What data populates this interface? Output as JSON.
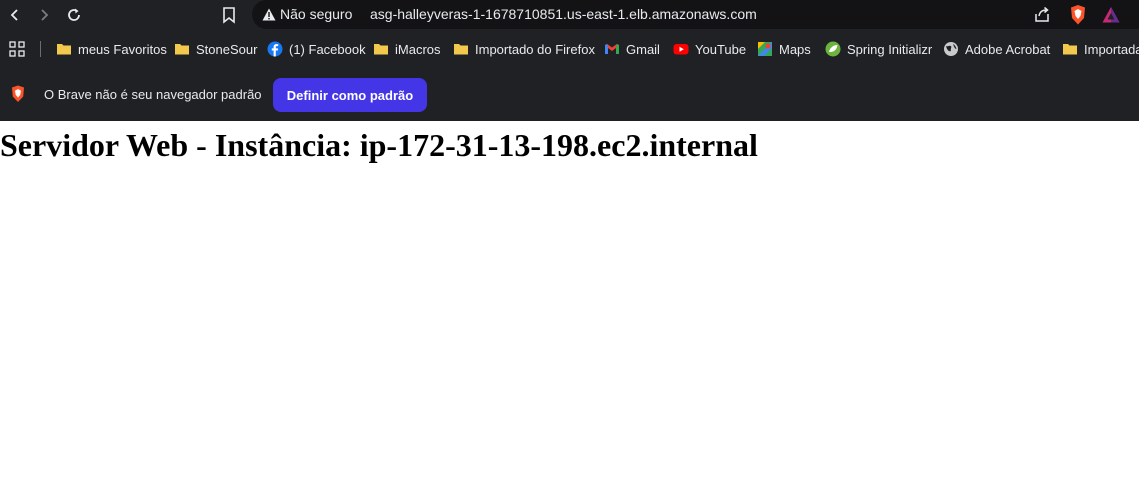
{
  "toolbar": {
    "security_label": "Não seguro",
    "url": "asg-halleyveras-1-1678710851.us-east-1.elb.amazonaws.com"
  },
  "bookmarks": [
    {
      "label": "meus Favoritos",
      "icon": "folder-icon"
    },
    {
      "label": "StoneSour",
      "icon": "folder-icon"
    },
    {
      "label": "(1) Facebook",
      "icon": "facebook-icon"
    },
    {
      "label": "iMacros",
      "icon": "folder-icon"
    },
    {
      "label": "Importado do Firefox",
      "icon": "folder-icon"
    },
    {
      "label": "Gmail",
      "icon": "gmail-icon"
    },
    {
      "label": "YouTube",
      "icon": "youtube-icon"
    },
    {
      "label": "Maps",
      "icon": "maps-icon"
    },
    {
      "label": "Spring Initializr",
      "icon": "spring-icon"
    },
    {
      "label": "Adobe Acrobat",
      "icon": "globe-icon"
    },
    {
      "label": "Importada",
      "icon": "folder-icon"
    }
  ],
  "infobar": {
    "message": "O Brave não é seu navegador padrão",
    "button_label": "Definir como padrão"
  },
  "page": {
    "heading": "Servidor Web - Instância: ip-172-31-13-198.ec2.internal"
  },
  "colors": {
    "chrome_bg": "#202124",
    "omnibox_bg": "#131316",
    "accent_button": "#4436e6",
    "folder": "#f2c94c"
  }
}
